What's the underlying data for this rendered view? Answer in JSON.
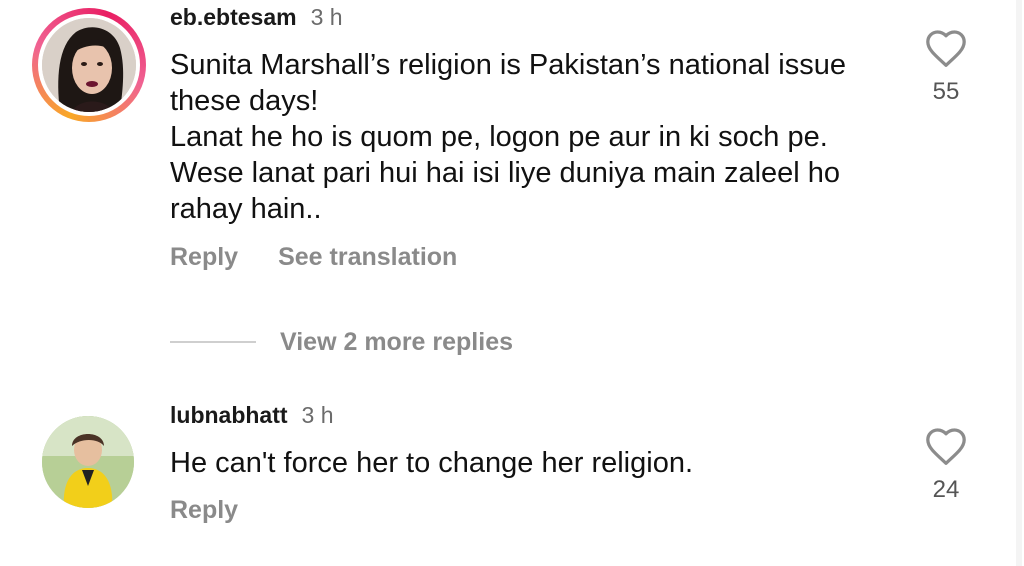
{
  "comments": [
    {
      "username": "eb.ebtesam",
      "time": "3 h",
      "text": "Sunita Marshall’s religion is Pakistan’s national issue\nthese days!\nLanat he ho is quom pe, logon pe aur in ki soch pe.\nWese lanat pari hui hai isi liye duniya main zaleel ho\nrahay hain..",
      "reply_label": "Reply",
      "translate_label": "See translation",
      "like_count": "55"
    },
    {
      "username": "lubnabhatt",
      "time": "3 h",
      "text": "He can't force her to change her religion.",
      "reply_label": "Reply",
      "like_count": "24"
    }
  ],
  "view_replies_label": "View 2 more replies",
  "icons": {
    "like": "heart-outline-icon"
  }
}
